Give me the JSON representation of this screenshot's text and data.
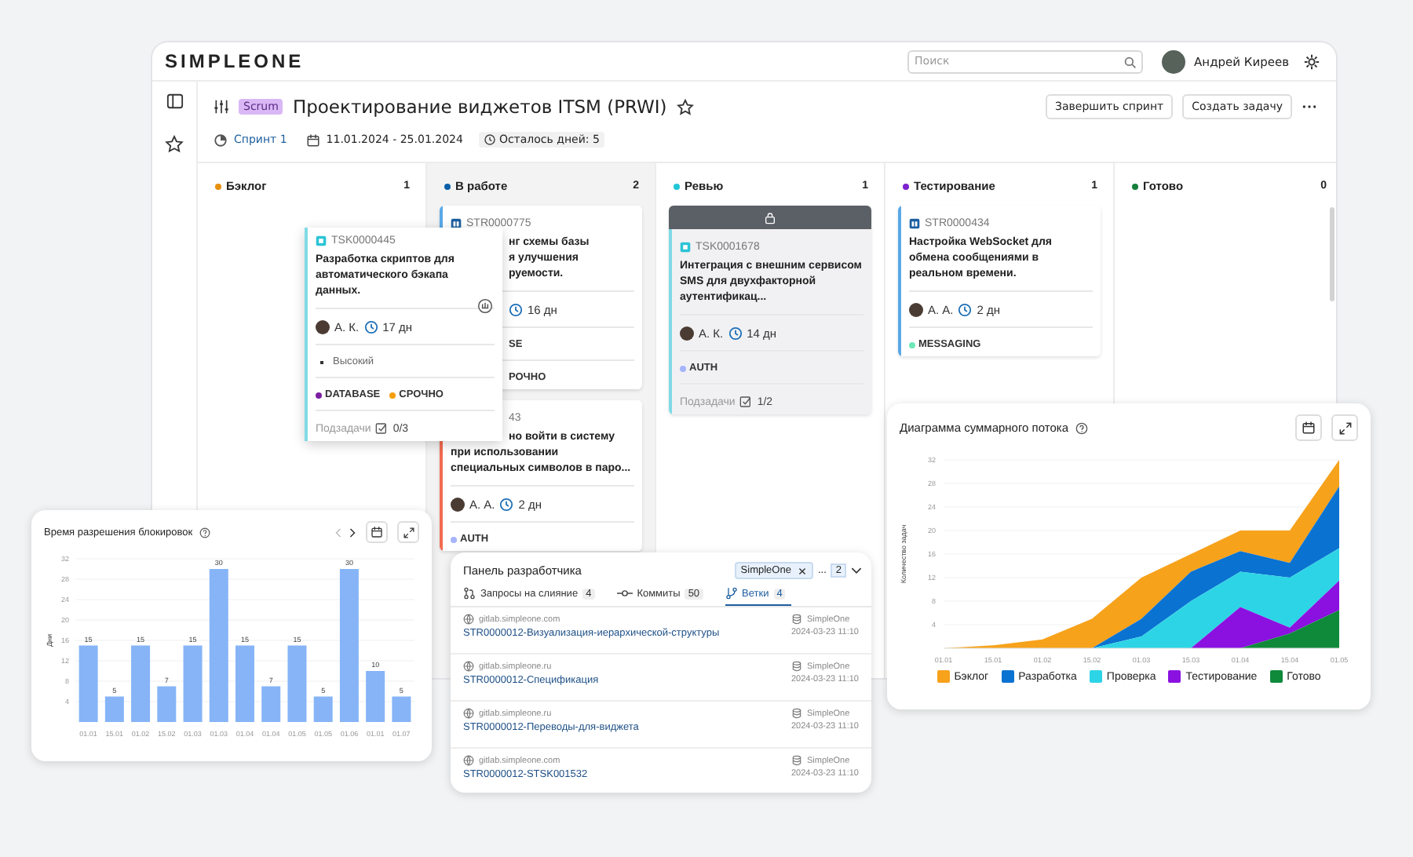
{
  "app": {
    "logo": "SIMPLEONE",
    "search": {
      "placeholder": "Поиск"
    },
    "user": "Андрей Киреев"
  },
  "project": {
    "method": "Scrum",
    "title": "Проектирование виджетов ITSM (PRWI)",
    "sprint": "Спринт 1",
    "dates": "11.01.2024 - 25.01.2024",
    "remaining": "Осталось дней: 5",
    "buttons": [
      "Завершить спринт",
      "Создать задачу"
    ]
  },
  "columns": [
    {
      "name": "Бэклог",
      "count": "1",
      "color": "#e8900c",
      "highlighted": false,
      "cards": [
        {
          "kind": "task",
          "color": "#7fdbe6",
          "locked": false,
          "dragged": true,
          "rows": [
            {
              "kind": "id",
              "text": "TSK0000445"
            },
            {
              "kind": "title",
              "text": "Разработка скриптов для автоматического бэкапа данных."
            },
            {
              "kind": "meta",
              "assignee": "А. К.",
              "days": "17 дн"
            },
            {
              "kind": "priority",
              "text": "Высокий"
            },
            {
              "kind": "tags",
              "tags": [
                {
                  "label": "DATABASE",
                  "color": "#7b1fa2"
                },
                {
                  "label": "СРОЧНО",
                  "color": "#f59e0b"
                }
              ]
            },
            {
              "kind": "subtasks",
              "label": "Подзадачи",
              "value": "0/3"
            }
          ]
        }
      ]
    },
    {
      "name": "В работе",
      "count": "2",
      "color": "#0b5fa8",
      "highlighted": true,
      "cards": [
        {
          "kind": "story",
          "color": "#5aa9e6",
          "locked": false,
          "dragged": false,
          "rows": [
            {
              "kind": "id",
              "text": "STR0000775"
            },
            {
              "kind": "title-cut",
              "text": "нг схемы базы"
            },
            {
              "kind": "title-cut",
              "text": "я улучшения"
            },
            {
              "kind": "title-cut",
              "text": "руемости."
            },
            {
              "kind": "meta-cut",
              "days": "16 дн"
            },
            {
              "kind": "tags-cut",
              "tags": [
                {
                  "label": "SE"
                }
              ]
            },
            {
              "kind": "tags-cut",
              "tags": [
                {
                  "label": "РОЧНО"
                }
              ]
            }
          ]
        },
        {
          "color": "#f26b50",
          "locked": false,
          "dragged": false,
          "rows": [
            {
              "kind": "id-cut",
              "text": "43"
            },
            {
              "kind": "title-cut",
              "text": "но войти в систему"
            },
            {
              "kind": "title",
              "text": "при использовании"
            },
            {
              "kind": "title",
              "text": "специальных символов в паро..."
            },
            {
              "kind": "meta",
              "assignee": "А. А.",
              "days": "2 дн"
            },
            {
              "kind": "tags",
              "tags": [
                {
                  "label": "AUTH",
                  "color": "#a5b4fc"
                }
              ]
            }
          ]
        }
      ]
    },
    {
      "name": "Ревью",
      "count": "1",
      "color": "#22c5d6",
      "highlighted": false,
      "cards": [
        {
          "kind": "task",
          "color": "#7fdbe6",
          "locked": true,
          "dragged": false,
          "rows": [
            {
              "kind": "id",
              "text": "TSK0001678"
            },
            {
              "kind": "title",
              "text": "Интеграция с внешним сервисом SMS для двухфакторной аутентификац..."
            },
            {
              "kind": "meta",
              "assignee": "А. К.",
              "days": "14 дн"
            },
            {
              "kind": "tags",
              "tags": [
                {
                  "label": "AUTH",
                  "color": "#a5b4fc"
                }
              ]
            },
            {
              "kind": "subtasks",
              "label": "Подзадачи",
              "value": "1/2"
            }
          ]
        }
      ]
    },
    {
      "name": "Тестирование",
      "count": "1",
      "color": "#7e22ce",
      "highlighted": false,
      "cards": [
        {
          "kind": "story",
          "color": "#5aa9e6",
          "locked": false,
          "dragged": false,
          "rows": [
            {
              "kind": "id",
              "text": "STR0000434"
            },
            {
              "kind": "title",
              "text": "Настройка WebSocket для обмена сообщениями в реальном времени."
            },
            {
              "kind": "meta",
              "assignee": "А. А.",
              "days": "2 дн"
            },
            {
              "kind": "tags",
              "tags": [
                {
                  "label": "MESSAGING",
                  "color": "#6ee7b7"
                }
              ]
            }
          ]
        }
      ]
    },
    {
      "name": "Готово",
      "count": "0",
      "color": "#15803d",
      "highlighted": false
    }
  ],
  "blocking_chart": {
    "title": "Время разрешения блокировок",
    "chart_data": {
      "type": "bar",
      "ylabel": "Дни",
      "categories": [
        "01.01",
        "15.01",
        "01.02",
        "15.02",
        "01.03",
        "01.03",
        "01.04",
        "01.04",
        "01.05",
        "01.05",
        "01.06",
        "01.01",
        "01.07"
      ],
      "values": [
        15,
        5,
        15,
        7,
        15,
        30,
        15,
        7,
        15,
        5,
        30,
        10,
        5
      ],
      "ylim": [
        0,
        32
      ],
      "yticks": [
        4,
        8,
        12,
        16,
        20,
        24,
        28,
        32
      ],
      "grid": true,
      "data_labels": true
    }
  },
  "dev_panel": {
    "title": "Панель разработчика",
    "filter": {
      "chip": "SimpleOne",
      "more": "...",
      "count": "2"
    },
    "tabs": [
      {
        "kind": "merge",
        "label": "Запросы на слияние",
        "count": "4",
        "selected": false
      },
      {
        "kind": "commit",
        "label": "Коммиты",
        "count": "50",
        "selected": false
      },
      {
        "kind": "branch",
        "label": "Ветки",
        "count": "4",
        "selected": true
      }
    ],
    "rows": [
      {
        "host": "gitlab.simpleone.com",
        "branch": "STR0000012-Визуализация-иерархической-структуры",
        "repo": "SimpleOne",
        "date": "2024-03-23 11:10"
      },
      {
        "host": "gitlab.simpleone.ru",
        "branch": "STR0000012-Спецификация",
        "repo": "SimpleOne",
        "date": "2024-03-23 11:10"
      },
      {
        "host": "gitlab.simpleone.ru",
        "branch": "STR0000012-Переводы-для-виджета",
        "repo": "SimpleOne",
        "date": "2024-03-23 11:10"
      },
      {
        "host": "gitlab.simpleone.com",
        "branch": "STR0000012-STSK001532",
        "repo": "SimpleOne",
        "date": "2024-03-23 11:10"
      }
    ]
  },
  "flow_chart": {
    "title": "Диаграмма суммарного потока",
    "chart_data": {
      "type": "area",
      "stacked": true,
      "ylabel": "Количество задач",
      "categories": [
        "01.01",
        "15.01",
        "01.02",
        "15.02",
        "01.03",
        "15.03",
        "01.04",
        "15.04",
        "01.05"
      ],
      "ylim": [
        0,
        32
      ],
      "yticks": [
        4,
        8,
        12,
        16,
        20,
        24,
        28,
        32
      ],
      "grid": true,
      "series": [
        {
          "name": "Бэклог",
          "color": "#f7a21b",
          "values": [
            0,
            0.5,
            1.5,
            5,
            7,
            3,
            3.5,
            5.5,
            4.5
          ]
        },
        {
          "name": "Разработка",
          "color": "#0a72d1",
          "values": [
            0,
            0,
            0,
            0,
            3,
            5,
            3.5,
            2.5,
            10.5
          ]
        },
        {
          "name": "Проверка",
          "color": "#2dd4e6",
          "values": [
            0,
            0,
            0,
            0,
            2,
            8,
            6,
            8.5,
            5.5
          ]
        },
        {
          "name": "Тестирование",
          "color": "#8a11e0",
          "values": [
            0,
            0,
            0,
            0,
            0,
            0,
            7,
            1,
            5
          ]
        },
        {
          "name": "Готово",
          "color": "#0e8a3a",
          "values": [
            0,
            0,
            0,
            0,
            0,
            0,
            0,
            2.5,
            6.5
          ]
        }
      ]
    }
  }
}
